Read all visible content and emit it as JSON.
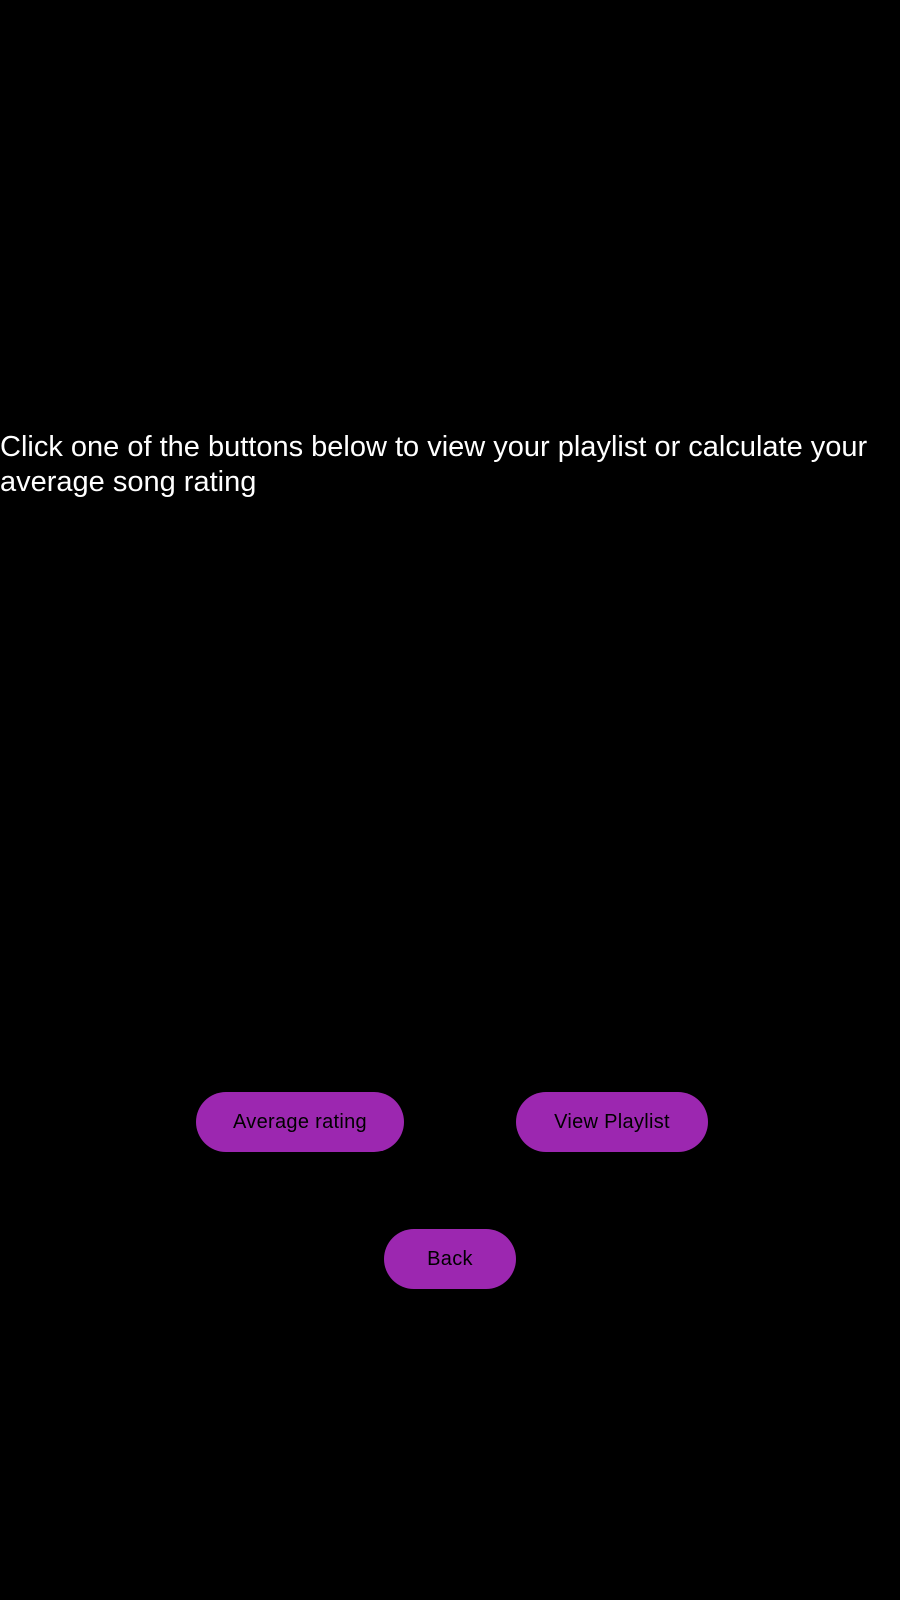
{
  "screen": {
    "instruction_text": "Click one of the buttons below to view your playlist or calculate your average song rating",
    "background_color": "#000000",
    "text_color": "#ffffff"
  },
  "buttons": {
    "average_rating_label": "Average rating",
    "view_playlist_label": "View Playlist",
    "back_label": "Back",
    "fill_color": "#9c27b0",
    "label_color": "#000000"
  }
}
